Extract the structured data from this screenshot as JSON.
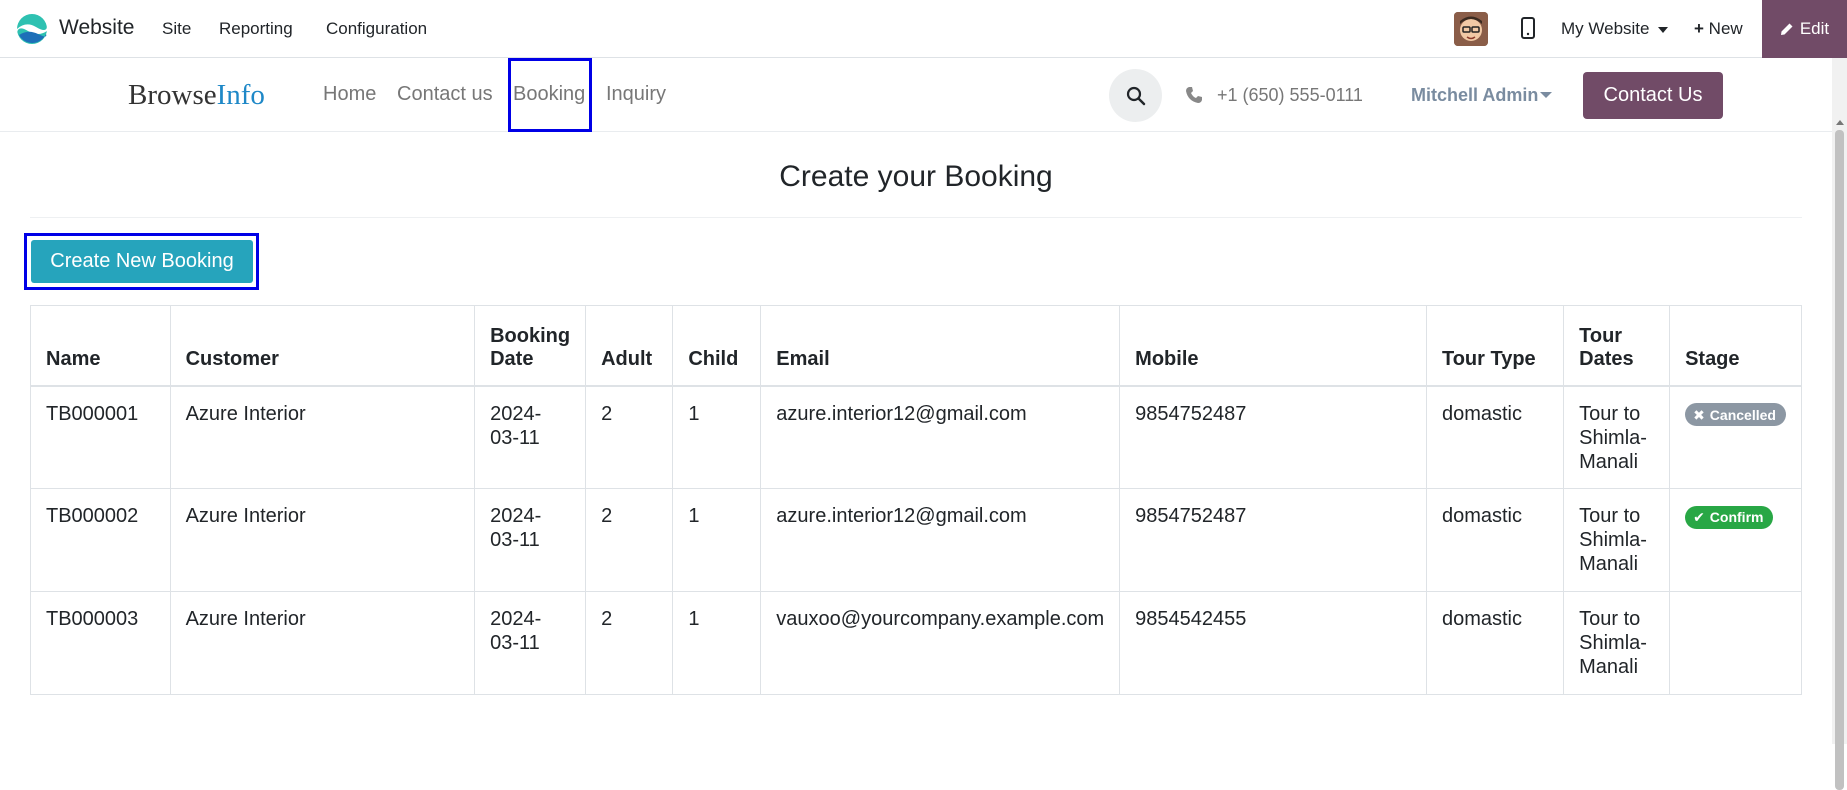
{
  "admin_bar": {
    "app_name": "Website",
    "menus": [
      "Site",
      "Reporting",
      "Configuration"
    ],
    "site_selector": "My Website",
    "new_label": "New",
    "edit_label": "Edit"
  },
  "site": {
    "brand_part1": "Browse",
    "brand_part2": "Info",
    "nav": [
      "Home",
      "Contact us",
      "Booking",
      "Inquiry"
    ],
    "phone": "+1 (650) 555-0111",
    "user": "Mitchell Admin",
    "contact_button": "Contact Us"
  },
  "main": {
    "title": "Create your Booking",
    "create_button": "Create New Booking"
  },
  "table": {
    "headers": [
      "Name",
      "Customer",
      "Booking Date",
      "Adult",
      "Child",
      "Email",
      "Mobile",
      "Tour Type",
      "Tour Dates",
      "Stage"
    ],
    "rows": [
      {
        "name": "TB000001",
        "customer": "Azure Interior",
        "date": "2024-03-11",
        "adult": "2",
        "child": "1",
        "email": "azure.interior12@gmail.com",
        "mobile": "9854752487",
        "tour_type": "domastic",
        "tour_dates": "Tour to Shimla-Manali",
        "stage": "Cancelled"
      },
      {
        "name": "TB000002",
        "customer": "Azure Interior",
        "date": "2024-03-11",
        "adult": "2",
        "child": "1",
        "email": "azure.interior12@gmail.com",
        "mobile": "9854752487",
        "tour_type": "domastic",
        "tour_dates": "Tour to Shimla-Manali",
        "stage": "Confirm"
      },
      {
        "name": "TB000003",
        "customer": "Azure Interior",
        "date": "2024-03-11",
        "adult": "2",
        "child": "1",
        "email": "vauxoo@yourcompany.example.com",
        "mobile": "9854542455",
        "tour_type": "domastic",
        "tour_dates": "Tour to Shimla-Manali",
        "stage": ""
      }
    ]
  },
  "colors": {
    "primary": "#714b67",
    "create_button": "#26a4bc",
    "highlight": "#0000e6",
    "cancelled": "#8c97a3",
    "confirm": "#28a745"
  },
  "icons": {
    "search": "search-icon",
    "phone": "phone-icon",
    "mobile_preview": "mobile-icon",
    "edit": "pencil-icon",
    "new": "plus-icon"
  }
}
